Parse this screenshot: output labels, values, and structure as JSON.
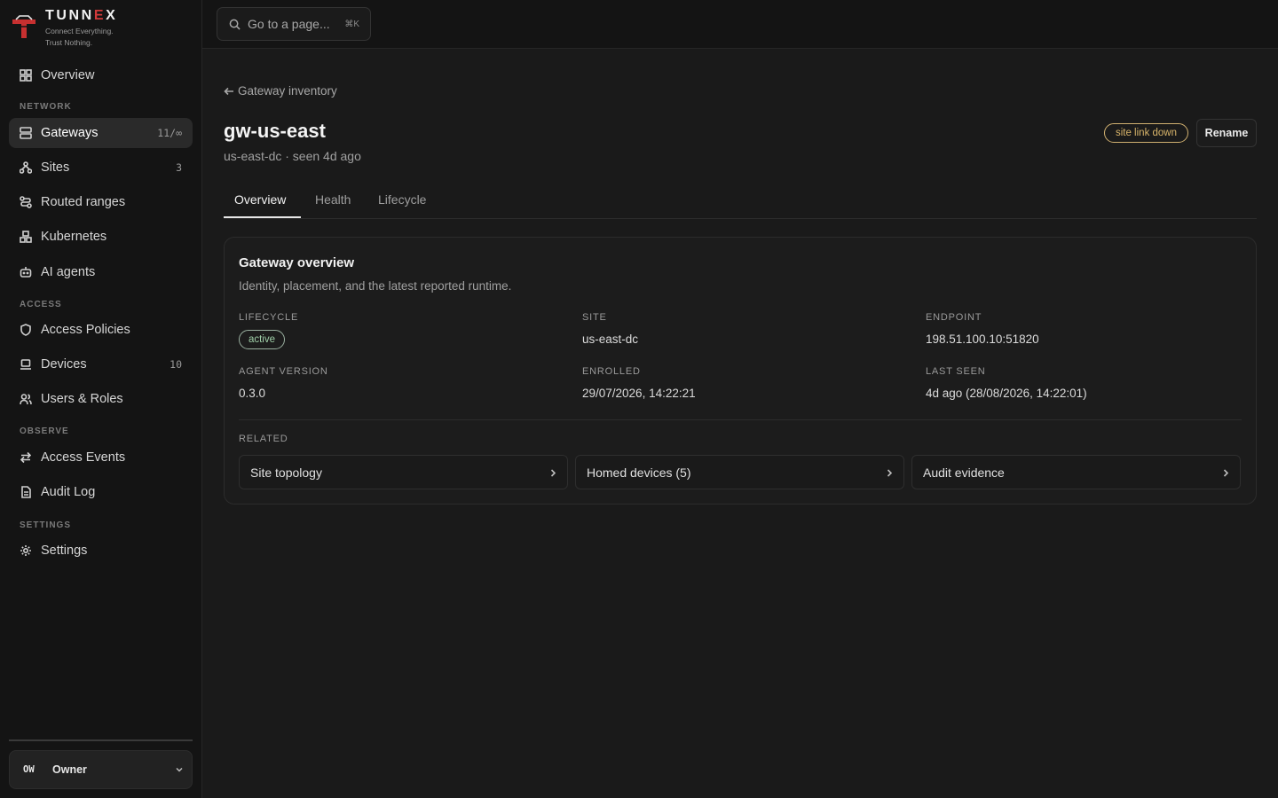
{
  "brand": {
    "name_prefix": "TUNN",
    "name_accent": "E",
    "name_suffix": "X",
    "tagline_line1": "Connect Everything.",
    "tagline_line2": "Trust Nothing."
  },
  "sidebar": {
    "overview": "Overview",
    "sections": {
      "network": "NETWORK",
      "access": "ACCESS",
      "observe": "OBSERVE",
      "settings": "SETTINGS"
    },
    "items": {
      "gateways": {
        "label": "Gateways",
        "count": "11/∞"
      },
      "sites": {
        "label": "Sites",
        "count": "3"
      },
      "routed_ranges": {
        "label": "Routed ranges"
      },
      "kubernetes": {
        "label": "Kubernetes"
      },
      "ai_agents": {
        "label": "AI agents"
      },
      "access_policies": {
        "label": "Access Policies"
      },
      "devices": {
        "label": "Devices",
        "count": "10"
      },
      "users_roles": {
        "label": "Users & Roles"
      },
      "access_events": {
        "label": "Access Events"
      },
      "audit_log": {
        "label": "Audit Log"
      },
      "settings": {
        "label": "Settings"
      }
    },
    "owner": {
      "initials": "OW",
      "name": "Owner"
    }
  },
  "topbar": {
    "search_placeholder": "Go to a page...",
    "search_shortcut": "⌘K"
  },
  "page": {
    "back_label": "Gateway inventory",
    "title": "gw-us-east",
    "subtitle": "us-east-dc · seen 4d ago",
    "status_badge": "site link down",
    "rename_label": "Rename",
    "tabs": [
      "Overview",
      "Health",
      "Lifecycle"
    ],
    "active_tab": "Overview"
  },
  "overview_card": {
    "title": "Gateway overview",
    "description": "Identity, placement, and the latest reported runtime.",
    "fields": {
      "lifecycle": {
        "label": "LIFECYCLE",
        "value": "active"
      },
      "site": {
        "label": "SITE",
        "value": "us-east-dc"
      },
      "endpoint": {
        "label": "ENDPOINT",
        "value": "198.51.100.10:51820"
      },
      "agent_version": {
        "label": "AGENT VERSION",
        "value": "0.3.0"
      },
      "enrolled": {
        "label": "ENROLLED",
        "value": "29/07/2026, 14:22:21"
      },
      "last_seen": {
        "label": "LAST SEEN",
        "value": "4d ago (28/08/2026, 14:22:01)"
      }
    },
    "related_label": "RELATED",
    "related": [
      "Site topology",
      "Homed devices (5)",
      "Audit evidence"
    ]
  },
  "colors": {
    "accent_red": "#d23a3a",
    "warning": "#d8b46a",
    "success": "#9fcfa8"
  }
}
